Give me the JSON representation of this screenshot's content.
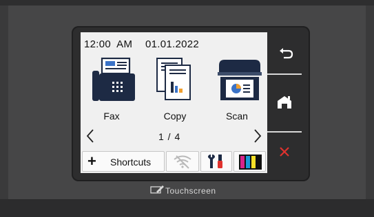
{
  "status": {
    "time": "12:00  AM",
    "date": "01.01.2022"
  },
  "apps": [
    {
      "label": "Fax",
      "icon": "fax-icon"
    },
    {
      "label": "Copy",
      "icon": "copy-icon"
    },
    {
      "label": "Scan",
      "icon": "scan-icon"
    }
  ],
  "pager": {
    "indicator": "1 / 4",
    "prev_icon": "chevron-left-icon",
    "next_icon": "chevron-right-icon"
  },
  "tray": {
    "shortcuts_label": "Shortcuts",
    "shortcuts_icon": "plus-icon",
    "wifi_icon": "wifi-off-icon",
    "tools_icon": "tools-icon",
    "ink_icon": "ink-levels-icon"
  },
  "side": {
    "back_icon": "back-icon",
    "home_icon": "home-icon",
    "cancel_icon": "close-icon"
  },
  "brand": {
    "text": "Touchscreen",
    "icon": "pen-touch-icon"
  },
  "colors": {
    "screen_bg": "#f0f0f0",
    "panel_bg": "#2d2d2e",
    "icon_navy": "#1d2a44",
    "accent_blue": "#3b73c7",
    "accent_orange": "#f0a030",
    "cancel_red": "#e0322e",
    "ink": [
      "#d8258a",
      "#1a9ad8",
      "#f5e028",
      "#111111"
    ]
  }
}
